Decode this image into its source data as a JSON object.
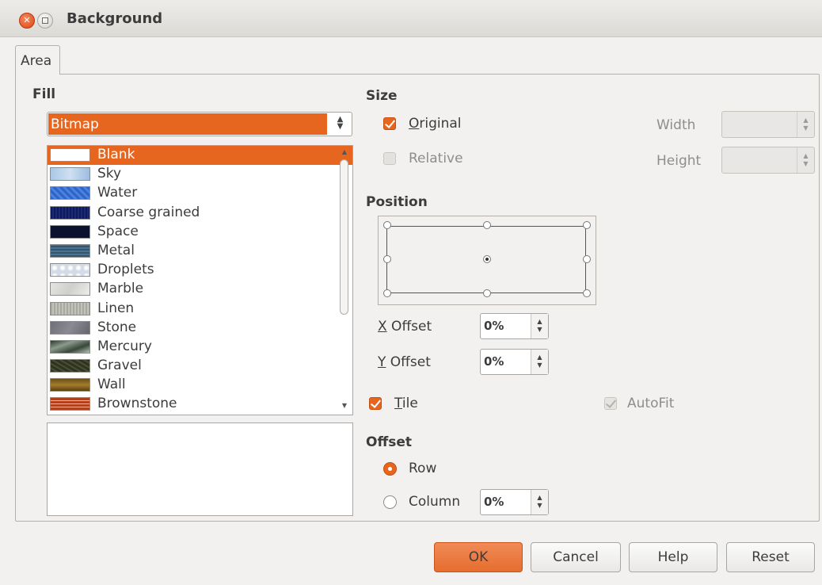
{
  "window": {
    "title": "Background"
  },
  "tabs": [
    {
      "label": "Area"
    }
  ],
  "fill": {
    "heading": "Fill",
    "selected_type": "Bitmap",
    "bitmaps": [
      {
        "label": "Blank",
        "selected": true
      },
      {
        "label": "Sky"
      },
      {
        "label": "Water"
      },
      {
        "label": "Coarse grained"
      },
      {
        "label": "Space"
      },
      {
        "label": "Metal"
      },
      {
        "label": "Droplets"
      },
      {
        "label": "Marble"
      },
      {
        "label": "Linen"
      },
      {
        "label": "Stone"
      },
      {
        "label": "Mercury"
      },
      {
        "label": "Gravel"
      },
      {
        "label": "Wall"
      },
      {
        "label": "Brownstone"
      }
    ]
  },
  "size": {
    "heading": "Size",
    "original_label": "Original",
    "original_checked": true,
    "relative_label": "Relative",
    "relative_checked": false,
    "width_label": "Width",
    "height_label": "Height",
    "width_value": "",
    "height_value": ""
  },
  "position": {
    "heading": "Position",
    "selected": "center",
    "x_offset_label": "X Offset",
    "x_offset_value": "0%",
    "y_offset_label": "Y Offset",
    "y_offset_value": "0%"
  },
  "tile": {
    "label": "Tile",
    "checked": true
  },
  "autofit": {
    "label": "AutoFit",
    "checked": true,
    "enabled": false
  },
  "offset": {
    "heading": "Offset",
    "row_label": "Row",
    "column_label": "Column",
    "selected": "row",
    "value": "0%"
  },
  "buttons": {
    "ok": "OK",
    "cancel": "Cancel",
    "help": "Help",
    "reset": "Reset"
  },
  "colors": {
    "accent": "#e6651f",
    "background": "#f2f1f0"
  }
}
